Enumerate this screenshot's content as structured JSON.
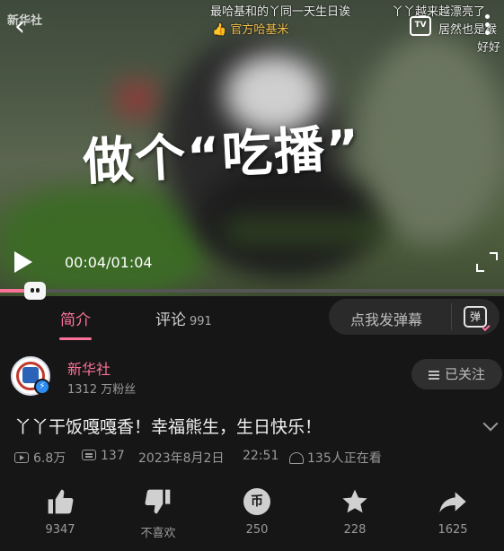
{
  "video": {
    "back_symbol": "‹",
    "watermark": "新华社",
    "danmaku": [
      "最哈基和的丫同一天生日诶",
      "丫丫越来越漂亮了",
      "👍 官方哈基米",
      "居然也是猴",
      "好好"
    ],
    "overlay_title": "做个“吃播”",
    "current_time": "00:04",
    "duration": "01:04",
    "time_display": "00:04/01:04",
    "progress": 0.0625,
    "tv_label": "TV"
  },
  "tabs": {
    "intro_label": "简介",
    "comments_label": "评论",
    "comments_count": "991",
    "danmaku_placeholder": "点我发弹幕",
    "danmaku_icon_label": "弹"
  },
  "author": {
    "name": "新华社",
    "fans": "1312 万粉丝",
    "follow_label": "已关注",
    "verify_symbol": "⚡"
  },
  "title": "丫丫干饭嘎嘎香！幸福熊生，生日快乐！",
  "meta": {
    "views": "6.8万",
    "danmaku_count": "137",
    "date": "2023年8月2日",
    "time": "22:51",
    "online": "135人正在看"
  },
  "actions": {
    "like": "9347",
    "dislike": "不喜欢",
    "coin": "250",
    "favorite": "228",
    "share": "1625",
    "coin_symbol": "币"
  },
  "colors": {
    "accent": "#fb7299",
    "background": "#161616",
    "secondary_text": "#9a9a9a"
  }
}
